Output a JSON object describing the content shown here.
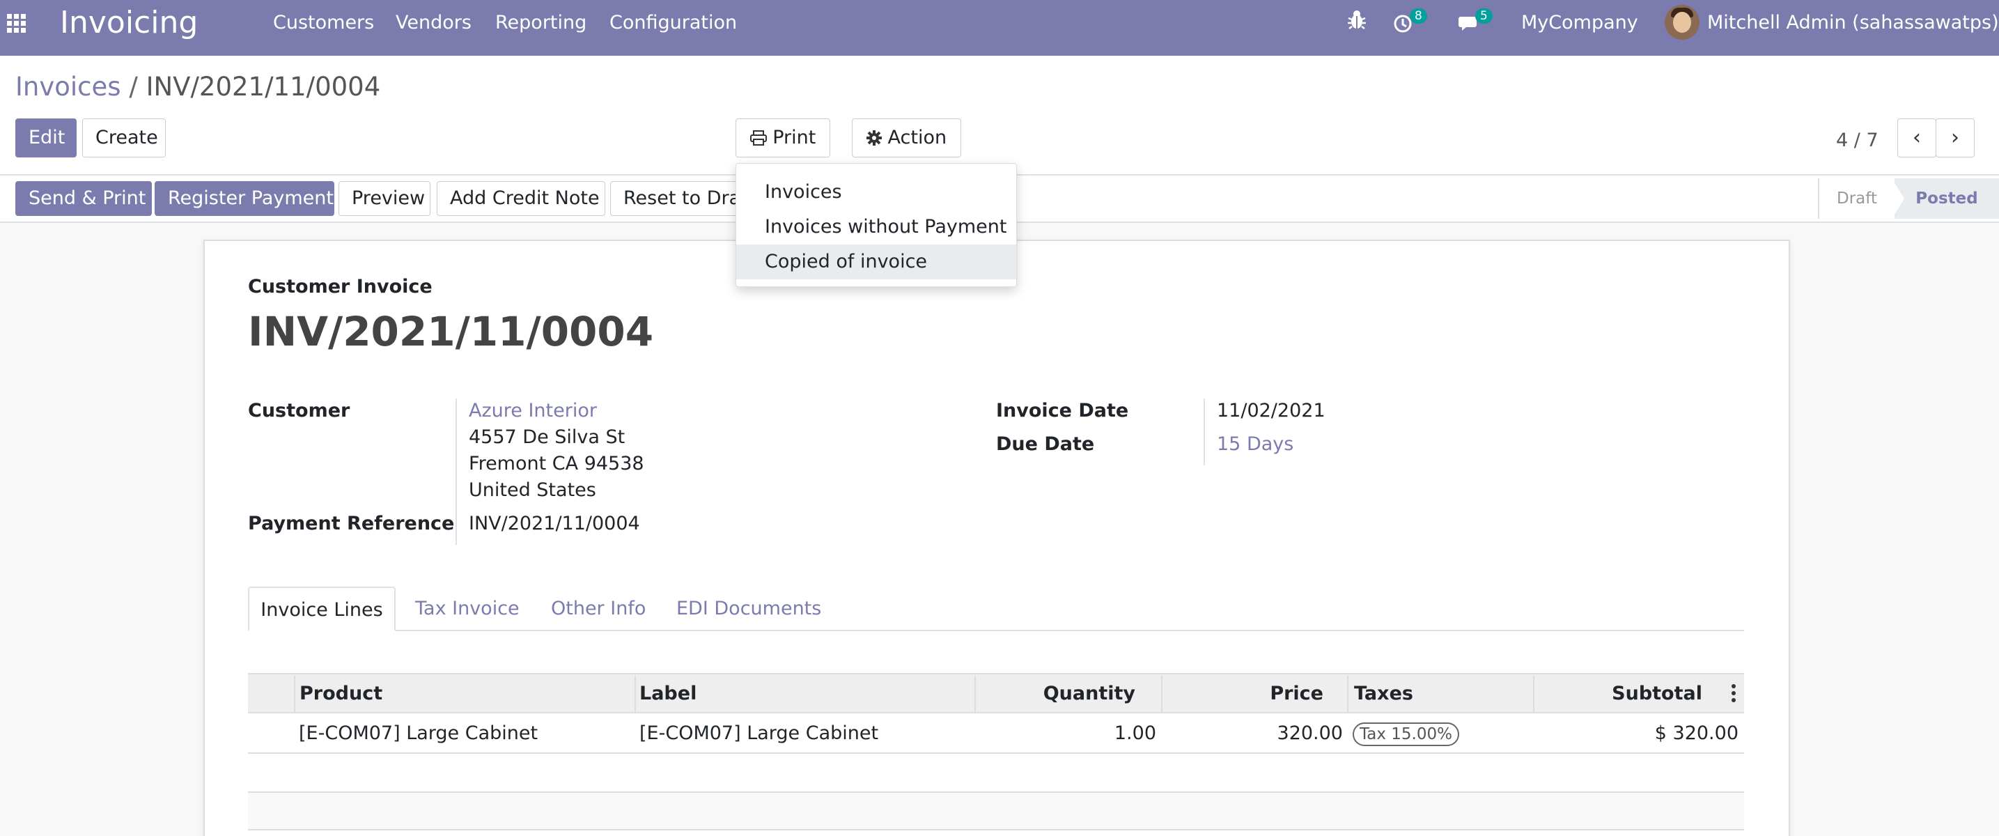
{
  "navbar": {
    "app_name": "Invoicing",
    "menus": [
      "Customers",
      "Vendors",
      "Reporting",
      "Configuration"
    ],
    "activity_count": "8",
    "messages_count": "5",
    "company": "MyCompany",
    "user": "Mitchell Admin (sahassawatps)"
  },
  "breadcrumb": {
    "parent": "Invoices",
    "separator": "/",
    "current": "INV/2021/11/0004"
  },
  "control_panel": {
    "edit": "Edit",
    "create": "Create",
    "print": "Print",
    "action": "Action",
    "pager": "4 / 7"
  },
  "print_menu": {
    "items": [
      "Invoices",
      "Invoices without Payment",
      "Copied of invoice"
    ],
    "highlighted": "Copied of invoice"
  },
  "statusbar": {
    "buttons": [
      "Send & Print",
      "Register Payment",
      "Preview",
      "Add Credit Note",
      "Reset to Draft"
    ],
    "stages": [
      "Draft",
      "Posted"
    ],
    "current_stage": "Posted"
  },
  "form": {
    "type_label": "Customer Invoice",
    "number": "INV/2021/11/0004",
    "customer_label": "Customer",
    "customer_name": "Azure Interior",
    "address": [
      "4557 De Silva St",
      "Fremont CA 94538",
      "United States"
    ],
    "payment_ref_label": "Payment Reference",
    "payment_ref": "INV/2021/11/0004",
    "invoice_date_label": "Invoice Date",
    "invoice_date": "11/02/2021",
    "due_date_label": "Due Date",
    "due_date": "15 Days"
  },
  "tabs": [
    "Invoice Lines",
    "Tax Invoice",
    "Other Info",
    "EDI Documents"
  ],
  "table": {
    "columns": [
      "Product",
      "Label",
      "Quantity",
      "Price",
      "Taxes",
      "Subtotal"
    ],
    "rows": [
      {
        "product": "[E-COM07] Large Cabinet",
        "label": "[E-COM07] Large Cabinet",
        "quantity": "1.00",
        "price": "320.00",
        "taxes": "Tax 15.00%",
        "subtotal": "$ 320.00"
      }
    ]
  },
  "colors": {
    "brand": "#7c7bad",
    "badge": "#00a09d"
  }
}
